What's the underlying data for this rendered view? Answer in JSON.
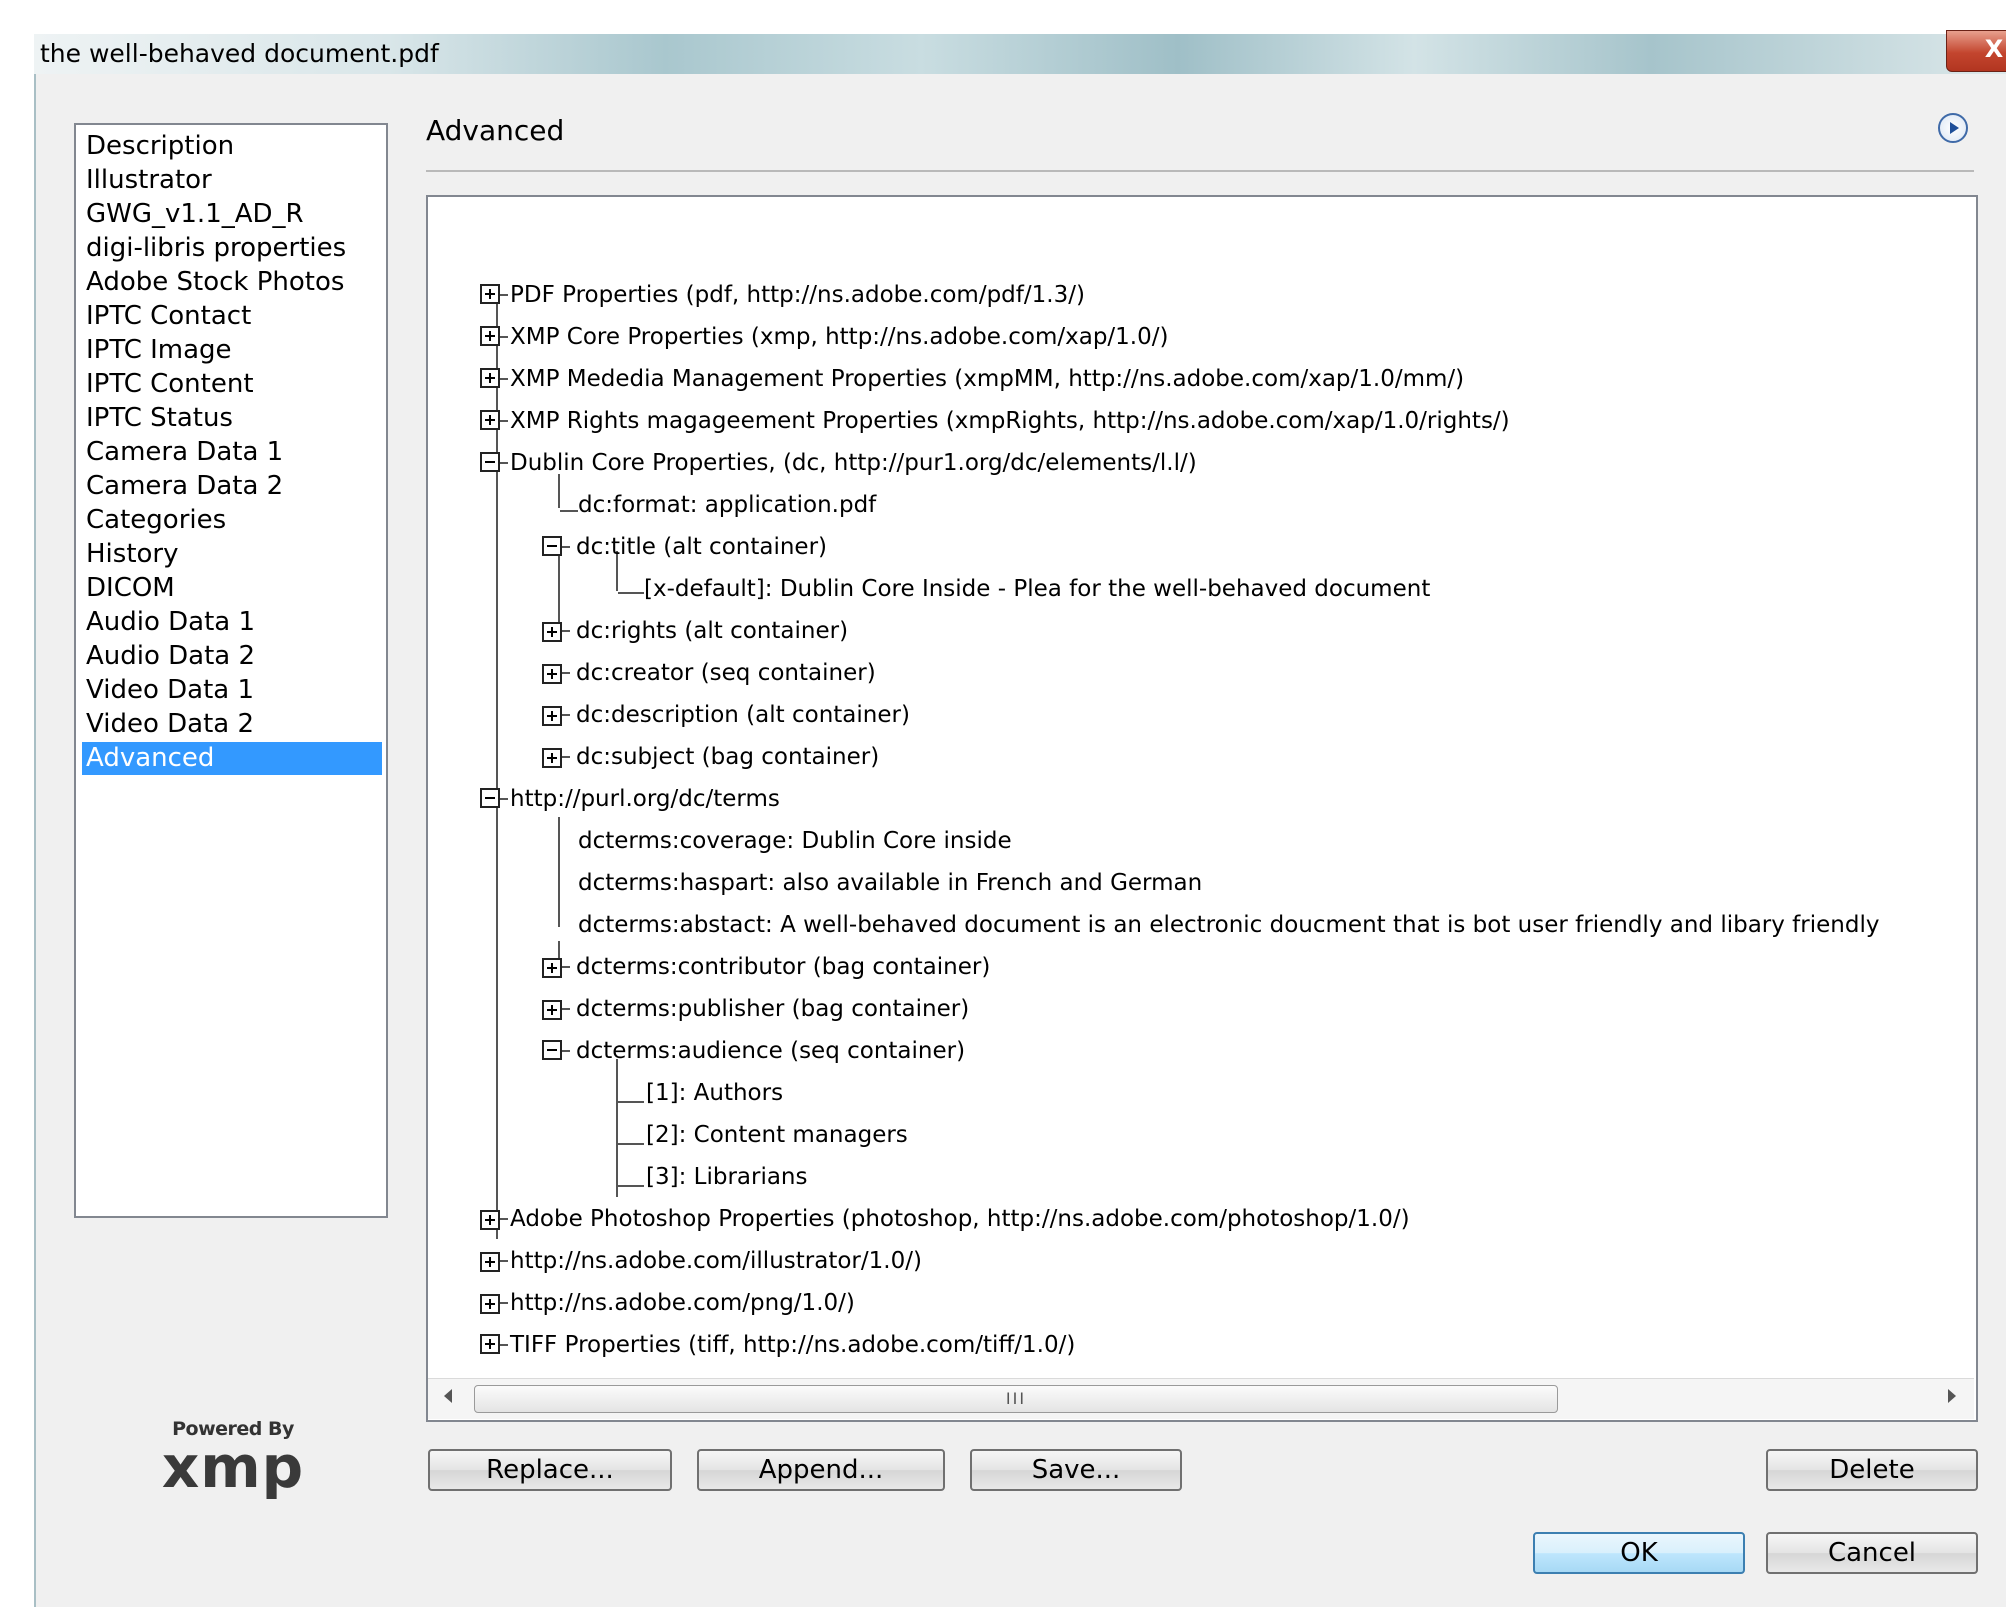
{
  "window": {
    "title": "the well-behaved document.pdf",
    "close_glyph": "X"
  },
  "categories": [
    "Description",
    "Illustrator",
    "GWG_v1.1_AD_R",
    "digi-libris properties",
    "Adobe Stock Photos",
    "IPTC Contact",
    "IPTC Image",
    "IPTC Content",
    "IPTC Status",
    "Camera Data 1",
    "Camera Data 2",
    "Categories",
    "History",
    "DICOM",
    "Audio Data 1",
    "Audio Data 2",
    "Video Data 1",
    "Video Data 2",
    "Advanced"
  ],
  "selected_category": "Advanced",
  "panel": {
    "title": "Advanced"
  },
  "tree": [
    "PDF Properties (pdf, http://ns.adobe.com/pdf/1.3/)",
    "XMP Core Properties (xmp, http://ns.adobe.com/xap/1.0/)",
    "XMP Mededia Management Properties (xmpMM, http://ns.adobe.com/xap/1.0/mm/)",
    "XMP Rights magageement Properties (xmpRights, http://ns.adobe.com/xap/1.0/rights/)",
    "Dublin Core Properties, (dc, http://pur1.org/dc/elements/l.l/)",
    "dc:format: application.pdf",
    "dc:title (alt container)",
    "[x-default]: Dublin Core Inside - Plea for the well-behaved document",
    "dc:rights (alt container)",
    "dc:creator (seq container)",
    "dc:description (alt container)",
    "dc:subject (bag container)",
    "http://purl.org/dc/terms",
    "dcterms:coverage: Dublin Core inside",
    "dcterms:haspart: also available in French and German",
    "dcterms:abstact: A well-behaved document is an electronic doucment that is bot user friendly and libary friendly",
    "dcterms:contributor (bag container)",
    "dcterms:publisher (bag container)",
    "dcterms:audience (seq container)",
    "[1]: Authors",
    "[2]: Content managers",
    "[3]: Librarians",
    "Adobe Photoshop Properties (photoshop, http://ns.adobe.com/photoshop/1.0/)",
    "http://ns.adobe.com/illustrator/1.0/)",
    "http://ns.adobe.com/png/1.0/)",
    "TIFF Properties (tiff, http://ns.adobe.com/tiff/1.0/)"
  ],
  "scrollbar": {
    "thumb_grip": "III"
  },
  "buttons": {
    "replace": "Replace...",
    "append": "Append...",
    "save": "Save...",
    "delete": "Delete",
    "ok": "OK",
    "cancel": "Cancel"
  },
  "logo": {
    "powered_by": "Powered By",
    "brand": "xmp"
  },
  "icons": {
    "expand": "plus-box-icon",
    "collapse": "minus-box-icon",
    "panel_menu": "play-circle-icon"
  }
}
